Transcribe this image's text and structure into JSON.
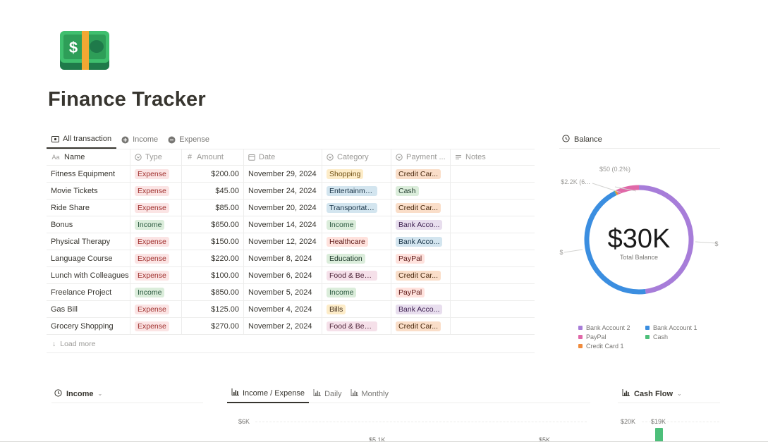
{
  "page": {
    "title": "Finance Tracker",
    "icon": "dollar-banknote-icon"
  },
  "tabs": [
    {
      "label": "All transaction",
      "icon": "table-icon",
      "active": true
    },
    {
      "label": "Income",
      "icon": "plus-circle-icon",
      "active": false
    },
    {
      "label": "Expense",
      "icon": "minus-circle-icon",
      "active": false
    }
  ],
  "table": {
    "columns": [
      "Name",
      "Type",
      "Amount",
      "Date",
      "Category",
      "Payment ...",
      "Notes"
    ],
    "rows": [
      {
        "name": "Fitness Equipment",
        "type": "Expense",
        "amount": "$200.00",
        "date": "November 29, 2024",
        "category": "Shopping",
        "payment": "Credit Car...",
        "notes": ""
      },
      {
        "name": "Movie Tickets",
        "type": "Expense",
        "amount": "$45.00",
        "date": "November 24, 2024",
        "category": "Entertainment",
        "payment": "Cash",
        "notes": ""
      },
      {
        "name": "Ride Share",
        "type": "Expense",
        "amount": "$85.00",
        "date": "November 20, 2024",
        "category": "Transportation",
        "payment": "Credit Car...",
        "notes": ""
      },
      {
        "name": "Bonus",
        "type": "Income",
        "amount": "$650.00",
        "date": "November 14, 2024",
        "category": "Income",
        "payment": "Bank Acco...",
        "notes": ""
      },
      {
        "name": "Physical Therapy",
        "type": "Expense",
        "amount": "$150.00",
        "date": "November 12, 2024",
        "category": "Healthcare",
        "payment": "Bank Acco...",
        "notes": ""
      },
      {
        "name": "Language Course",
        "type": "Expense",
        "amount": "$220.00",
        "date": "November 8, 2024",
        "category": "Education",
        "payment": "PayPal",
        "notes": ""
      },
      {
        "name": "Lunch with Colleagues",
        "type": "Expense",
        "amount": "$100.00",
        "date": "November 6, 2024",
        "category": "Food & Bever...",
        "payment": "Credit Car...",
        "notes": ""
      },
      {
        "name": "Freelance Project",
        "type": "Income",
        "amount": "$850.00",
        "date": "November 5, 2024",
        "category": "Income",
        "payment": "PayPal",
        "notes": ""
      },
      {
        "name": "Gas Bill",
        "type": "Expense",
        "amount": "$125.00",
        "date": "November 4, 2024",
        "category": "Bills",
        "payment": "Bank Acco...",
        "notes": ""
      },
      {
        "name": "Grocery Shopping",
        "type": "Expense",
        "amount": "$270.00",
        "date": "November 2, 2024",
        "category": "Food & Bever...",
        "payment": "Credit Car...",
        "notes": ""
      }
    ],
    "load_more": "Load more"
  },
  "tag_colors": {
    "Expense": {
      "bg": "#fbe4e4",
      "fg": "#9f2f2d"
    },
    "Income": {
      "bg": "#dbeddb",
      "fg": "#2b593f"
    },
    "Shopping": {
      "bg": "#fdecc8",
      "fg": "#6e4f13"
    },
    "Entertainment": {
      "bg": "#d3e5ef",
      "fg": "#183347"
    },
    "Transportation": {
      "bg": "#d3e5ef",
      "fg": "#183347"
    },
    "Healthcare": {
      "bg": "#ffe2dd",
      "fg": "#5d1715"
    },
    "Education": {
      "bg": "#dbeddb",
      "fg": "#1c3829"
    },
    "Food & Bever...": {
      "bg": "#f5e0e9",
      "fg": "#4c2337"
    },
    "Bills": {
      "bg": "#fdecc8",
      "fg": "#402c1b"
    },
    "Credit Car...": {
      "bg": "#fadec9",
      "fg": "#49290e"
    },
    "Cash": {
      "bg": "#dbeddb",
      "fg": "#1c3829"
    },
    "Bank Acco...": {
      "bg": "#d3e5ef",
      "fg": "#183347"
    },
    "Bank Acco...#2": {
      "bg": "#e8deee",
      "fg": "#412454"
    },
    "PayPal": {
      "bg": "#ffe2dd",
      "fg": "#5d1715"
    }
  },
  "balance": {
    "title": "Balance",
    "center_value": "$30K",
    "center_label": "Total Balance",
    "outer_labels": [
      "$50 (0.2%)",
      "$2.2K (6...",
      "$",
      "$"
    ],
    "chart_data": {
      "type": "pie",
      "series": [
        {
          "name": "Bank Account 2",
          "value": 0.48,
          "color": "#a77dd9"
        },
        {
          "name": "Bank Account 1",
          "value": 0.445,
          "color": "#3b8ee0"
        },
        {
          "name": "PayPal",
          "value": 0.068,
          "color": "#e068a8"
        },
        {
          "name": "Cash",
          "value": 0.002,
          "color": "#4dbf7a"
        },
        {
          "name": "Credit Card 1",
          "value": 0.005,
          "color": "#f08b3c"
        }
      ]
    }
  },
  "bottom": {
    "income_title": "Income",
    "ie_tabs": [
      {
        "label": "Income / Expense",
        "active": true
      },
      {
        "label": "Daily",
        "active": false
      },
      {
        "label": "Monthly",
        "active": false
      }
    ],
    "ie_axis": "$6K",
    "ie_values": [
      "$5.1K",
      "$5K"
    ],
    "cashflow_title": "Cash Flow",
    "cashflow_axis": "$20K",
    "cashflow_value": "$19K"
  }
}
